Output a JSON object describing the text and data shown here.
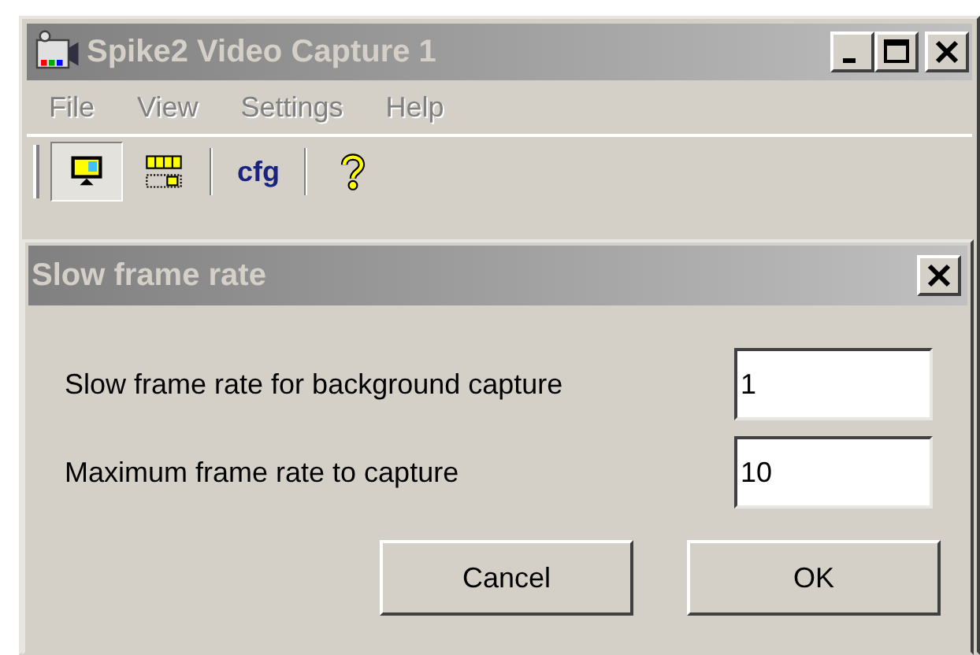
{
  "window": {
    "title": "Spike2 Video Capture 1",
    "active": false
  },
  "menu": [
    {
      "label": "File",
      "disabled": true
    },
    {
      "label": "View",
      "disabled": true
    },
    {
      "label": "Settings",
      "disabled": true
    },
    {
      "label": "Help",
      "disabled": true
    }
  ],
  "toolbar": [
    {
      "kind": "monitor",
      "pressed": true
    },
    {
      "kind": "film",
      "pressed": false
    },
    {
      "kind": "separator"
    },
    {
      "kind": "text",
      "label": "cfg",
      "pressed": false
    },
    {
      "kind": "separator"
    },
    {
      "kind": "help",
      "pressed": false
    }
  ],
  "dialog": {
    "title": "Slow frame rate",
    "fields": [
      {
        "label": "Slow frame rate for background capture",
        "value": "1"
      },
      {
        "label": "Maximum frame rate to capture",
        "value": "10"
      }
    ],
    "buttons": [
      "Cancel",
      "OK"
    ]
  }
}
